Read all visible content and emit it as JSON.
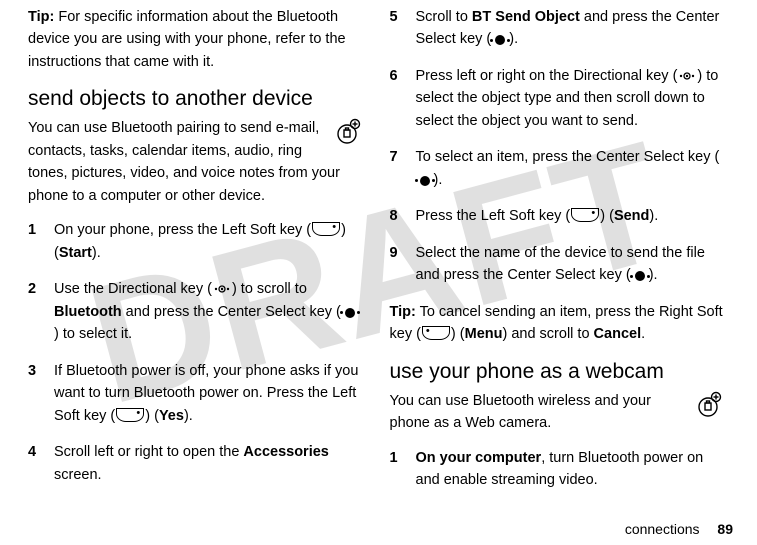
{
  "watermark": "DRAFT",
  "left": {
    "tip_label": "Tip:",
    "tip_text": " For specific information about the Bluetooth device you are using with your phone, refer to the instructions that came with it.",
    "section_heading": "send objects to another device",
    "intro": "You can use Bluetooth pairing to send e-mail, contacts, tasks, calendar items, audio, ring tones, pictures, video, and voice notes from your phone to a computer or other device.",
    "steps": [
      {
        "num": "1",
        "pre": "On your phone, press the Left Soft key (",
        "post": ") (",
        "label": "Start",
        "end": ")."
      },
      {
        "num": "2",
        "pre": "Use the Directional key (",
        "mid": ") to scroll to ",
        "target": "Bluetooth",
        "post2": " and press the Center Select key (",
        "end": ") to select it."
      },
      {
        "num": "3",
        "pre": "If Bluetooth power is off, your phone asks if you want to turn Bluetooth power on. Press the Left Soft key (",
        "post": ") (",
        "label": "Yes",
        "end": ")."
      },
      {
        "num": "4",
        "pre": "Scroll left or right to open the ",
        "target": "Accessories",
        "post": " screen."
      }
    ]
  },
  "right": {
    "steps": [
      {
        "num": "5",
        "pre": "Scroll to ",
        "target": "BT Send Object",
        "mid": " and press the Center Select key (",
        "end": ")."
      },
      {
        "num": "6",
        "pre": "Press left or right on the Directional key (",
        "post": ") to select the object type and then scroll down to select the object you want to send."
      },
      {
        "num": "7",
        "pre": "To select an item, press the Center Select key (",
        "end": ")."
      },
      {
        "num": "8",
        "pre": "Press the Left Soft key (",
        "post": ") (",
        "label": "Send",
        "end": ")."
      },
      {
        "num": "9",
        "pre": "Select the name of the device to send the file and press the Center Select key (",
        "end": ")."
      }
    ],
    "tip_label": "Tip:",
    "tip_pre": " To cancel sending an item, press the Right Soft key (",
    "tip_mid": ") (",
    "tip_label2": "Menu",
    "tip_post": ") and scroll to ",
    "tip_target": "Cancel",
    "tip_end": ".",
    "section_heading": "use your phone as a webcam",
    "intro": "You can use Bluetooth wireless and your phone as a Web camera.",
    "step1_num": "1",
    "step1_bold": "On your computer",
    "step1_rest": ", turn Bluetooth power on and enable streaming video."
  },
  "footer": {
    "section": "connections",
    "page": "89"
  }
}
